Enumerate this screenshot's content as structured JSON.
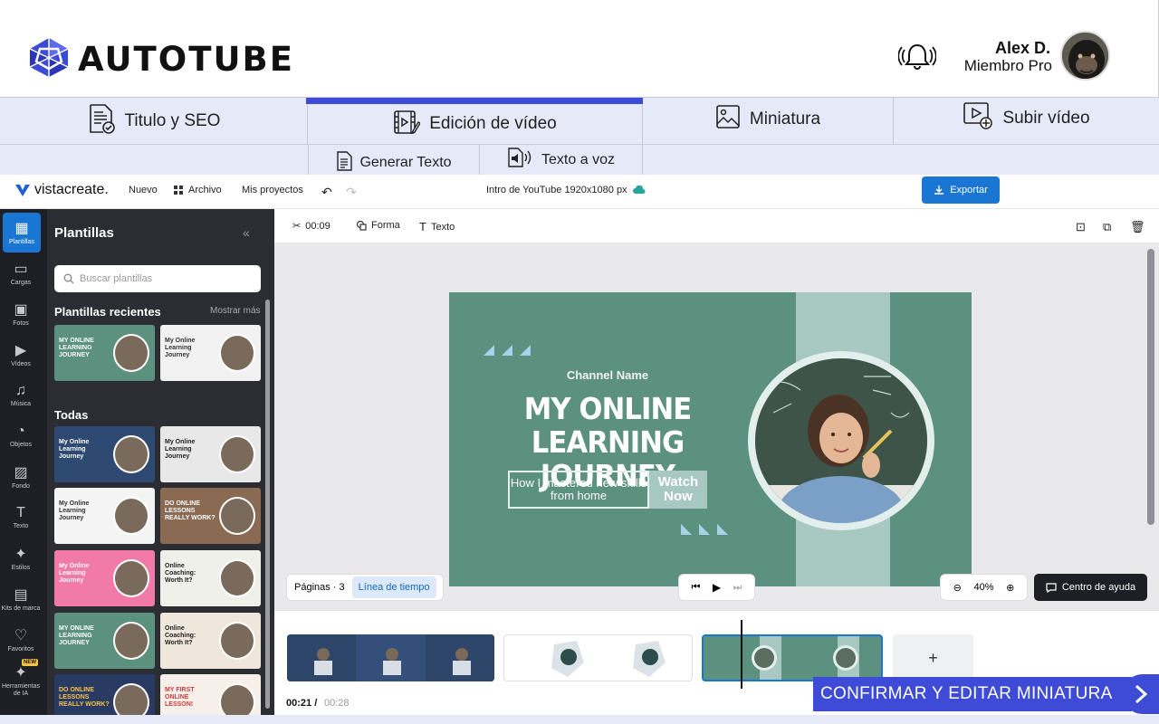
{
  "brand": {
    "name": "AUTOTUBE",
    "accent": "#3d4bd6"
  },
  "user": {
    "name": "Alex D.",
    "role": "Miembro Pro"
  },
  "tabs": [
    {
      "label": "Titulo y SEO",
      "icon": "seo-document-icon"
    },
    {
      "label": "Edición de vídeo",
      "icon": "video-edit-icon",
      "active": true
    },
    {
      "label": "Miniatura",
      "icon": "image-icon"
    },
    {
      "label": "Subir vídeo",
      "icon": "video-upload-icon"
    }
  ],
  "subtabs": [
    {
      "label": "Generar Texto",
      "icon": "document-icon"
    },
    {
      "label": "Texto a voz",
      "icon": "speaker-document-icon"
    }
  ],
  "editor": {
    "logo": "vistacreate.",
    "menu": {
      "new": "Nuevo",
      "file": "Archivo",
      "projects": "Mis proyectos"
    },
    "doc_title": "Intro de YouTube 1920x1080 px",
    "export": "Exportar",
    "rail": [
      {
        "label": "Plantillas",
        "active": true
      },
      {
        "label": "Cargas"
      },
      {
        "label": "Fotos"
      },
      {
        "label": "Vídeos"
      },
      {
        "label": "Música"
      },
      {
        "label": "Objetos"
      },
      {
        "label": "Fondo"
      },
      {
        "label": "Texto"
      },
      {
        "label": "Estilos"
      },
      {
        "label": "Kits de marca"
      },
      {
        "label": "Favoritos"
      },
      {
        "label": "Herramientas de IA",
        "badge": "NEW"
      }
    ],
    "panel": {
      "title": "Plantillas",
      "search_placeholder": "Buscar plantillas",
      "recent_title": "Plantillas recientes",
      "show_more": "Mostrar más",
      "all_title": "Todas",
      "thumb_texts": {
        "t1": "MY ONLINE LEARNING JOURNEY",
        "t2": "My Online Learning Journey",
        "t3": "My Online Learning Journey",
        "t4": "My Online Learning Journey",
        "t5": "My Online Learning Journey",
        "t6": "DO ONLINE LESSONS REALLY WORK?",
        "t7": "My Online Learning Journey",
        "t8": "Online Coaching: Worth It?",
        "t9": "MY ONLINE LEARNING JOURNEY",
        "t10": "Online Coaching: Worth It?",
        "t11": "DO ONLINE LESSONS REALLY WORK?",
        "t12": "MY FIRST ONLINE LESSON!"
      }
    },
    "toolbar": {
      "duration": "00:09",
      "shape": "Forma",
      "text": "Texto"
    },
    "design": {
      "channel": "Channel Name",
      "title_line1": "MY ONLINE",
      "title_line2": "LEARNING JOURNEY",
      "subtitle": "How I mastered new skills from home",
      "cta": "Watch Now",
      "bg_color": "#5b917e",
      "stripe_color": "#a8c8c2"
    },
    "pages": {
      "label": "Páginas · 3",
      "timeline": "Línea de tiempo"
    },
    "zoom": "40%",
    "help": "Centro de ayuda",
    "time": {
      "current": "00:21",
      "separator": "/",
      "total": "00:28"
    },
    "add_clip": "+"
  },
  "confirm": "CONFIRMAR Y EDITAR MINIATURA"
}
